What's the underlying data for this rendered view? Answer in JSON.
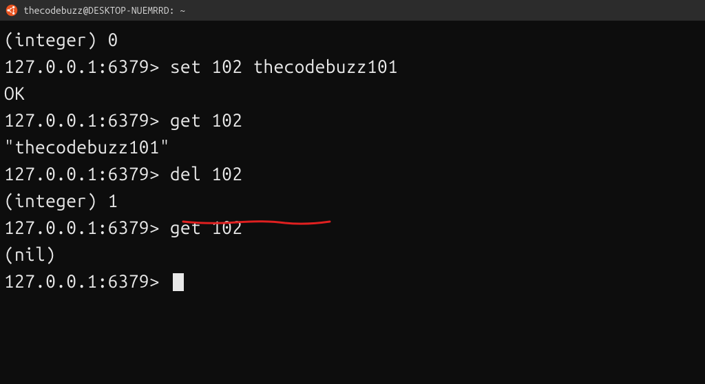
{
  "titlebar": {
    "title": "thecodebuzz@DESKTOP-NUEMRRD: ~"
  },
  "terminal": {
    "prompt": "127.0.0.1:6379>",
    "lines": [
      {
        "type": "output",
        "text": "(integer) 0"
      },
      {
        "type": "command",
        "cmd": "set 102 thecodebuzz101"
      },
      {
        "type": "output",
        "text": "OK"
      },
      {
        "type": "command",
        "cmd": "get 102"
      },
      {
        "type": "output",
        "text": "\"thecodebuzz101\""
      },
      {
        "type": "command",
        "cmd": "del 102"
      },
      {
        "type": "output",
        "text": "(integer) 1"
      },
      {
        "type": "command",
        "cmd": "get 102"
      },
      {
        "type": "output",
        "text": "(nil)"
      },
      {
        "type": "command",
        "cmd": ""
      }
    ]
  },
  "annotation": {
    "color": "#e02020"
  }
}
